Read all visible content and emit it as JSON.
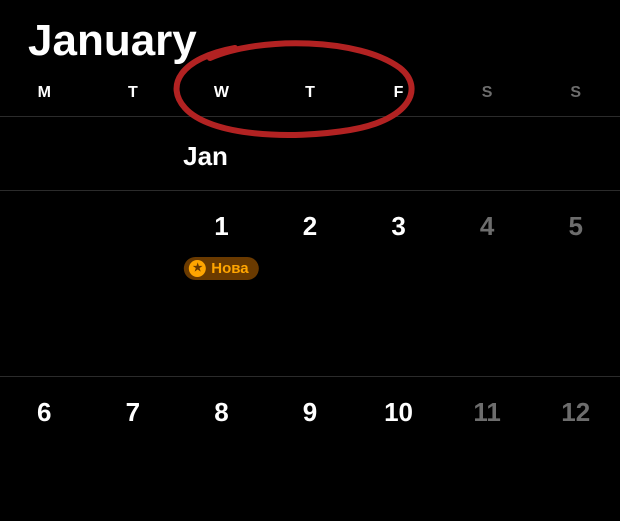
{
  "header": {
    "month_title": "January"
  },
  "weekdays": {
    "mon": "M",
    "tue": "T",
    "wed": "W",
    "thu": "T",
    "fri": "F",
    "sat": "S",
    "sun": "S"
  },
  "month_short": "Jan",
  "weeks": [
    {
      "days": [
        {
          "num": "",
          "weekend": false
        },
        {
          "num": "",
          "weekend": false
        },
        {
          "num": "1",
          "weekend": false,
          "event": {
            "label": "Нова",
            "icon": "star"
          }
        },
        {
          "num": "2",
          "weekend": false
        },
        {
          "num": "3",
          "weekend": false
        },
        {
          "num": "4",
          "weekend": true
        },
        {
          "num": "5",
          "weekend": true
        }
      ]
    },
    {
      "days": [
        {
          "num": "6",
          "weekend": false
        },
        {
          "num": "7",
          "weekend": false
        },
        {
          "num": "8",
          "weekend": false
        },
        {
          "num": "9",
          "weekend": false
        },
        {
          "num": "10",
          "weekend": false
        },
        {
          "num": "11",
          "weekend": true
        },
        {
          "num": "12",
          "weekend": true
        }
      ]
    }
  ],
  "annotation": {
    "color": "#b22222"
  }
}
